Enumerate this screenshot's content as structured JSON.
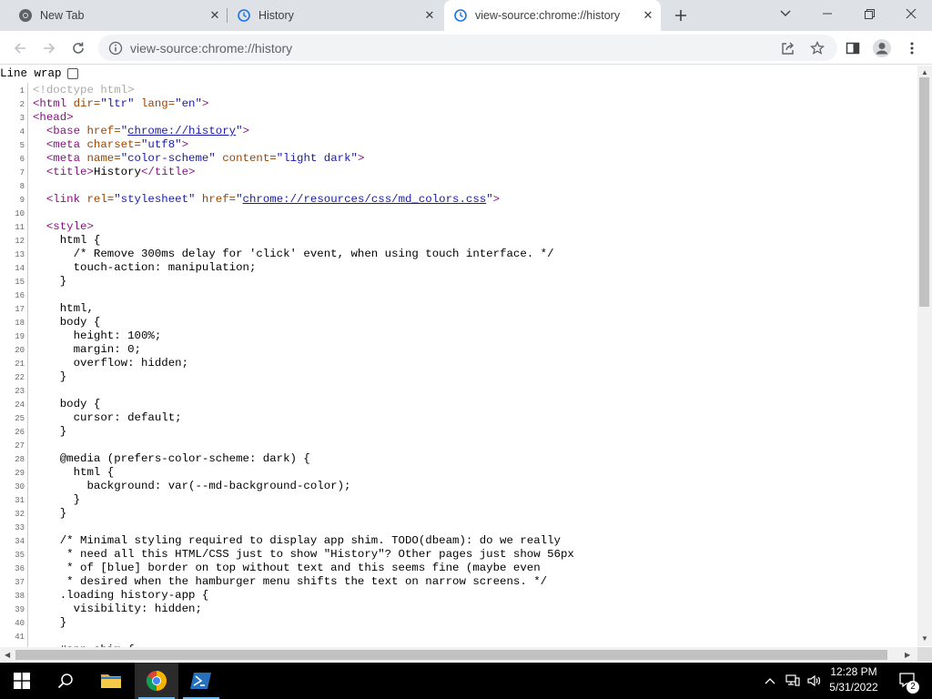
{
  "tabs": [
    {
      "title": "New Tab",
      "icon": "chrome-icon",
      "active": false
    },
    {
      "title": "History",
      "icon": "history-icon",
      "active": false
    },
    {
      "title": "view-source:chrome://history",
      "icon": "history-icon",
      "active": true
    }
  ],
  "window_controls": {
    "tab_search": "chevron-down-icon",
    "minimize": "minimize-icon",
    "restore": "restore-icon",
    "close": "close-icon"
  },
  "toolbar": {
    "url": "view-source:chrome://history",
    "icons": [
      "back-icon",
      "forward-icon",
      "reload-icon",
      "info-icon",
      "share-icon",
      "star-icon",
      "side-panel-icon",
      "profile-icon",
      "menu-icon"
    ]
  },
  "line_wrap": {
    "label": "Line wrap",
    "checked": false
  },
  "source_lines": [
    [
      {
        "t": "<!doctype html>",
        "c": "cm"
      }
    ],
    [
      {
        "t": "<html ",
        "c": "tag"
      },
      {
        "t": "dir=",
        "c": "attr"
      },
      {
        "t": "\"ltr\" ",
        "c": "val"
      },
      {
        "t": "lang=",
        "c": "attr"
      },
      {
        "t": "\"en\"",
        "c": "val"
      },
      {
        "t": ">",
        "c": "tag"
      }
    ],
    [
      {
        "t": "<head>",
        "c": "tag"
      }
    ],
    [
      {
        "t": "  "
      },
      {
        "t": "<base ",
        "c": "tag"
      },
      {
        "t": "href=",
        "c": "attr"
      },
      {
        "t": "\"",
        "c": "val"
      },
      {
        "t": "chrome://history",
        "c": "link"
      },
      {
        "t": "\"",
        "c": "val"
      },
      {
        "t": ">",
        "c": "tag"
      }
    ],
    [
      {
        "t": "  "
      },
      {
        "t": "<meta ",
        "c": "tag"
      },
      {
        "t": "charset=",
        "c": "attr"
      },
      {
        "t": "\"utf8\"",
        "c": "val"
      },
      {
        "t": ">",
        "c": "tag"
      }
    ],
    [
      {
        "t": "  "
      },
      {
        "t": "<meta ",
        "c": "tag"
      },
      {
        "t": "name=",
        "c": "attr"
      },
      {
        "t": "\"color-scheme\" ",
        "c": "val"
      },
      {
        "t": "content=",
        "c": "attr"
      },
      {
        "t": "\"light dark\"",
        "c": "val"
      },
      {
        "t": ">",
        "c": "tag"
      }
    ],
    [
      {
        "t": "  "
      },
      {
        "t": "<title>",
        "c": "tag"
      },
      {
        "t": "History"
      },
      {
        "t": "</title>",
        "c": "tag"
      }
    ],
    [],
    [
      {
        "t": "  "
      },
      {
        "t": "<link ",
        "c": "tag"
      },
      {
        "t": "rel=",
        "c": "attr"
      },
      {
        "t": "\"stylesheet\" ",
        "c": "val"
      },
      {
        "t": "href=",
        "c": "attr"
      },
      {
        "t": "\"",
        "c": "val"
      },
      {
        "t": "chrome://resources/css/md_colors.css",
        "c": "link"
      },
      {
        "t": "\"",
        "c": "val"
      },
      {
        "t": ">",
        "c": "tag"
      }
    ],
    [],
    [
      {
        "t": "  "
      },
      {
        "t": "<style>",
        "c": "tag"
      }
    ],
    [
      {
        "t": "    html {"
      }
    ],
    [
      {
        "t": "      /* Remove 300ms delay for 'click' event, when using touch interface. */"
      }
    ],
    [
      {
        "t": "      touch-action: manipulation;"
      }
    ],
    [
      {
        "t": "    }"
      }
    ],
    [],
    [
      {
        "t": "    html,"
      }
    ],
    [
      {
        "t": "    body {"
      }
    ],
    [
      {
        "t": "      height: 100%;"
      }
    ],
    [
      {
        "t": "      margin: 0;"
      }
    ],
    [
      {
        "t": "      overflow: hidden;"
      }
    ],
    [
      {
        "t": "    }"
      }
    ],
    [],
    [
      {
        "t": "    body {"
      }
    ],
    [
      {
        "t": "      cursor: default;"
      }
    ],
    [
      {
        "t": "    }"
      }
    ],
    [],
    [
      {
        "t": "    @media (prefers-color-scheme: dark) {"
      }
    ],
    [
      {
        "t": "      html {"
      }
    ],
    [
      {
        "t": "        background: var(--md-background-color);"
      }
    ],
    [
      {
        "t": "      }"
      }
    ],
    [
      {
        "t": "    }"
      }
    ],
    [],
    [
      {
        "t": "    /* Minimal styling required to display app shim. TODO(dbeam): do we really"
      }
    ],
    [
      {
        "t": "     * need all this HTML/CSS just to show \"History\"? Other pages just show 56px"
      }
    ],
    [
      {
        "t": "     * of [blue] border on top without text and this seems fine (maybe even"
      }
    ],
    [
      {
        "t": "     * desired when the hamburger menu shifts the text on narrow screens. */"
      }
    ],
    [
      {
        "t": "    .loading history-app {"
      }
    ],
    [
      {
        "t": "      visibility: hidden;"
      }
    ],
    [
      {
        "t": "    }"
      }
    ],
    [],
    [
      {
        "t": "    #app-shim {"
      }
    ]
  ],
  "taskbar": {
    "items": [
      "windows-start-icon",
      "search-icon",
      "file-explorer-icon",
      "chrome-icon",
      "powershell-icon"
    ],
    "active": "chrome-icon",
    "tray": [
      "chevron-up-icon",
      "network-icon",
      "volume-icon"
    ],
    "time": "12:28 PM",
    "date": "5/31/2022",
    "notification_count": "2"
  }
}
